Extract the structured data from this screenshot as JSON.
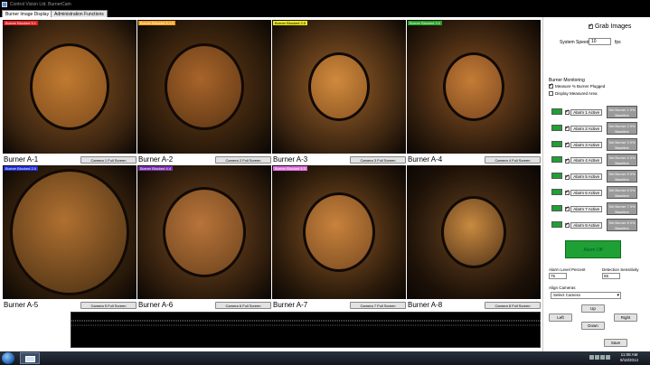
{
  "window": {
    "title": "Control Vision Ltd. BurnerCam"
  },
  "tabs": [
    {
      "label": "Burner Image Display",
      "active": true
    },
    {
      "label": "Administration Functions",
      "active": false
    }
  ],
  "cameras": [
    {
      "name": "Burner A-1",
      "button": "Camera 1 Full Screen",
      "badge": "Burner Blocked 5.1",
      "badge_color": "#e02020",
      "badge_text_color": "#fff"
    },
    {
      "name": "Burner A-2",
      "button": "Camera 2 Full Screen",
      "badge": "Burner Blocked 5.4.5",
      "badge_color": "#f0a020",
      "badge_text_color": "#fff"
    },
    {
      "name": "Burner A-3",
      "button": "Camera 3 Full Screen",
      "badge": "Burner Blocked 2.5",
      "badge_color": "#e8e81a",
      "badge_text_color": "#000"
    },
    {
      "name": "Burner A-4",
      "button": "Camera 4 Full Screen",
      "badge": "Burner Blocked 3.0",
      "badge_color": "#20a020",
      "badge_text_color": "#fff"
    },
    {
      "name": "Burner A-5",
      "button": "Camera 5 Full Screen",
      "badge": "Burner Blocked 2.0",
      "badge_color": "#2030e0",
      "badge_text_color": "#fff"
    },
    {
      "name": "Burner A-6",
      "button": "Camera 6 Full Screen",
      "badge": "Burner Blocked 4.4",
      "badge_color": "#7a30b0",
      "badge_text_color": "#fff"
    },
    {
      "name": "Burner A-7",
      "button": "Camera 7 Full Screen",
      "badge": "Burner Blocked 4.3",
      "badge_color": "#e070e0",
      "badge_text_color": "#fff"
    },
    {
      "name": "Burner A-8",
      "button": "Camera 8 Full Screen",
      "badge": "",
      "badge_color": "",
      "badge_text_color": ""
    }
  ],
  "panel": {
    "grab_images": {
      "label": "Grab Images",
      "checked": true
    },
    "system_speed": {
      "label": "System Speed",
      "value": "10",
      "unit": "fps"
    },
    "burner_monitoring": {
      "title": "Burner Monitoring",
      "options": [
        {
          "label": "Measure % Burner Plugged",
          "checked": true
        },
        {
          "label": "Display Measured Area",
          "checked": false
        }
      ]
    },
    "alarms": [
      {
        "label": "Alarm 1 Active",
        "checked": true,
        "set_label": "Set Burner 1 0% Baseline"
      },
      {
        "label": "Alarm 2 Active",
        "checked": true,
        "set_label": "Set Burner 2 0% Baseline"
      },
      {
        "label": "Alarm 3 Active",
        "checked": true,
        "set_label": "Set Burner 3 0% Baseline"
      },
      {
        "label": "Alarm 4 Active",
        "checked": true,
        "set_label": "Set Burner 4 0% Baseline"
      },
      {
        "label": "Alarm 5 Active",
        "checked": true,
        "set_label": "Set Burner 5 0% Baseline"
      },
      {
        "label": "Alarm 6 Active",
        "checked": true,
        "set_label": "Set Burner 6 0% Baseline"
      },
      {
        "label": "Alarm 7 Active",
        "checked": true,
        "set_label": "Set Burner 7 0% Baseline"
      },
      {
        "label": "Alarm 8 Active",
        "checked": true,
        "set_label": "Set Burner 8 0% Baseline"
      }
    ],
    "alarm_button": "Alarm Off",
    "alarm_level": {
      "label": "Alarm Level Percent",
      "value": "75"
    },
    "detection": {
      "label": "Detection Sensitivity",
      "value": "55"
    },
    "align": {
      "label": "Align Cameras",
      "select_value": "Select Camera",
      "up": "Up",
      "left": "Left",
      "right": "Right",
      "down": "Down"
    },
    "save": "Save"
  },
  "taskbar": {
    "time": "11:08 AM",
    "date": "9/18/2014"
  }
}
